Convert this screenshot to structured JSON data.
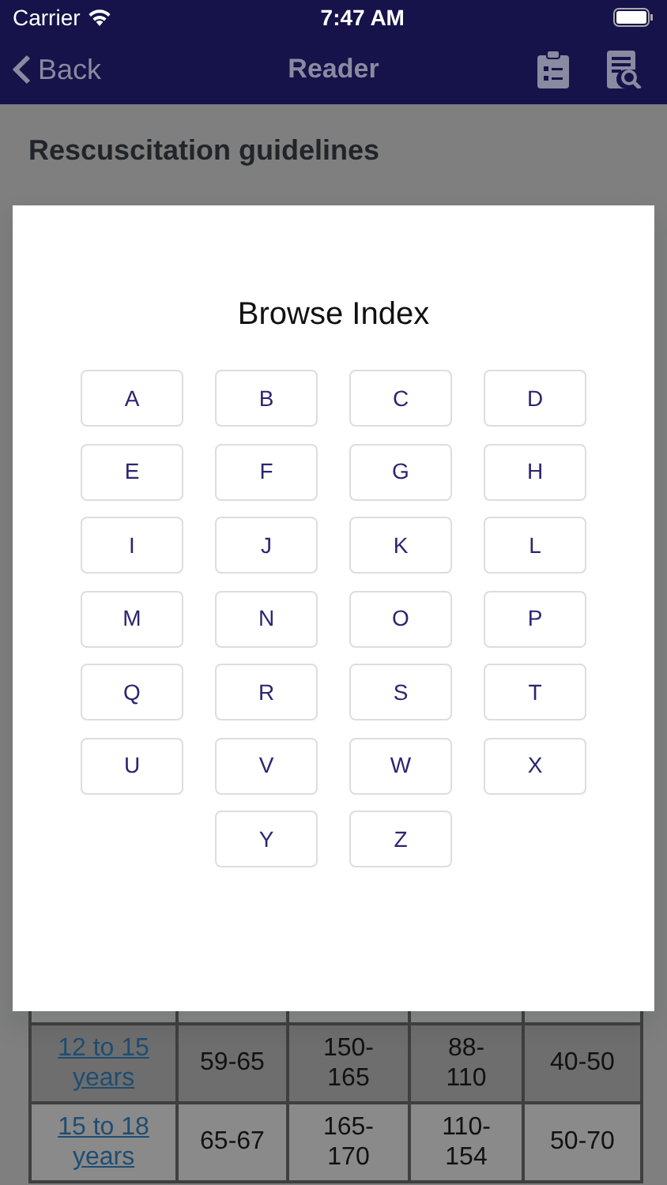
{
  "status_bar": {
    "carrier": "Carrier",
    "time": "7:47 AM"
  },
  "nav": {
    "back": "Back",
    "title": "Reader"
  },
  "page": {
    "heading": "Rescuscitation guidelines"
  },
  "modal": {
    "title": "Browse Index",
    "letters": [
      "A",
      "B",
      "C",
      "D",
      "E",
      "F",
      "G",
      "H",
      "I",
      "J",
      "K",
      "L",
      "M",
      "N",
      "O",
      "P",
      "Q",
      "R",
      "S",
      "T",
      "U",
      "V",
      "W",
      "X",
      "Y",
      "Z"
    ]
  },
  "table": {
    "rows": [
      [
        "12 to 15 years",
        "59-65",
        "150-165",
        "88-110",
        "40-50"
      ],
      [
        "15 to 18 years",
        "65-67",
        "165-170",
        "110-154",
        "50-70"
      ]
    ]
  }
}
